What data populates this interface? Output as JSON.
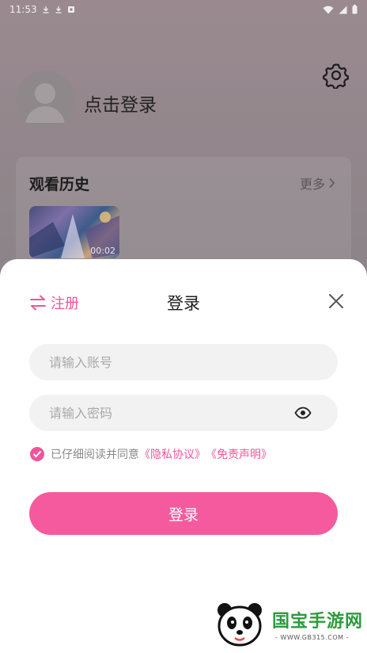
{
  "status_bar": {
    "time": "11:53",
    "left_icons": [
      "download-icon",
      "download-icon",
      "app-notification-icon"
    ],
    "right_icons": [
      "wifi-icon",
      "signal-icon",
      "battery-icon"
    ]
  },
  "profile": {
    "login_prompt": "点击登录",
    "settings_icon": "gear-icon"
  },
  "history": {
    "title": "观看历史",
    "more_label": "更多",
    "items": [
      {
        "duration": "00:02"
      }
    ]
  },
  "login_sheet": {
    "register_label": "注册",
    "title": "登录",
    "account_placeholder": "请输入账号",
    "password_placeholder": "请输入密码",
    "agreement_prefix": "已仔细阅读并同意",
    "privacy_link": "《隐私协议》",
    "disclaimer_link": "《免责声明》",
    "login_button": "登录",
    "agreement_checked": true
  },
  "watermark": {
    "name": "国宝手游网",
    "url": "- WWW.GB315.COM -"
  },
  "colors": {
    "accent": "#f0559a",
    "button": "#f55a9e",
    "field_bg": "#f2f2f2",
    "dim_overlay": "#8c8488"
  }
}
